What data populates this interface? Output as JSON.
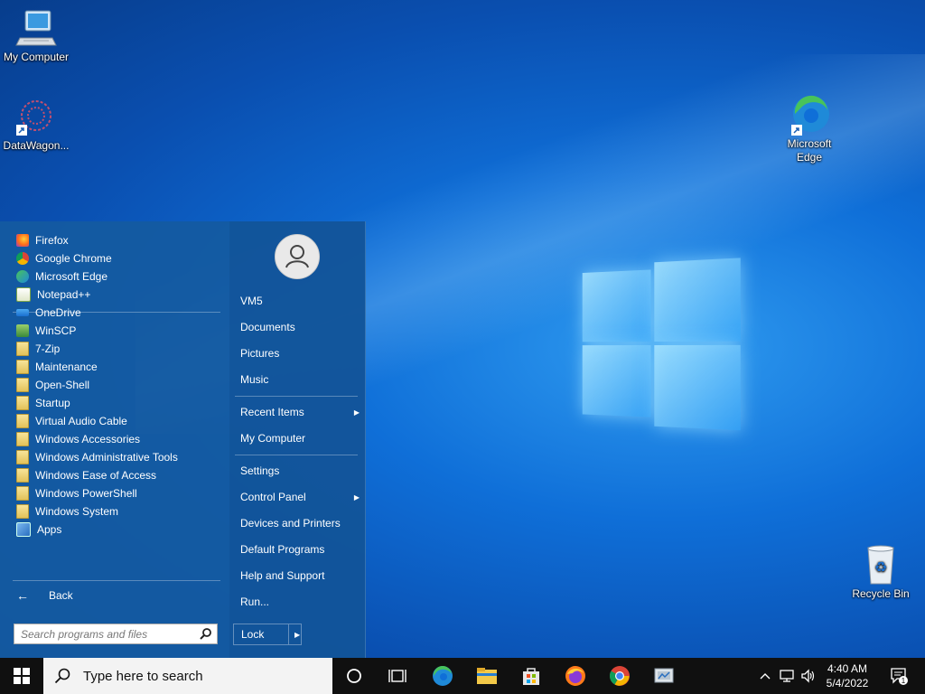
{
  "desktop": {
    "icons": [
      {
        "label": "My Computer"
      },
      {
        "label": "DataWagon..."
      },
      {
        "label": "Microsoft Edge"
      },
      {
        "label": "Recycle Bin"
      }
    ]
  },
  "start_menu": {
    "programs": [
      {
        "label": "Firefox",
        "icon": "firefox-icon"
      },
      {
        "label": "Google Chrome",
        "icon": "chrome-icon"
      },
      {
        "label": "Microsoft Edge",
        "icon": "edge-icon"
      },
      {
        "label": "Notepad++",
        "icon": "notepadpp-icon"
      },
      {
        "label": "OneDrive",
        "icon": "onedrive-icon"
      },
      {
        "label": "WinSCP",
        "icon": "winscp-icon"
      },
      {
        "label": "7-Zip",
        "icon": "folder-icon"
      },
      {
        "label": "Maintenance",
        "icon": "folder-icon"
      },
      {
        "label": "Open-Shell",
        "icon": "folder-icon"
      },
      {
        "label": "Startup",
        "icon": "folder-icon"
      },
      {
        "label": "Virtual Audio Cable",
        "icon": "folder-icon"
      },
      {
        "label": "Windows Accessories",
        "icon": "folder-icon"
      },
      {
        "label": "Windows Administrative Tools",
        "icon": "folder-icon"
      },
      {
        "label": "Windows Ease of Access",
        "icon": "folder-icon"
      },
      {
        "label": "Windows PowerShell",
        "icon": "folder-icon"
      },
      {
        "label": "Windows System",
        "icon": "folder-icon"
      },
      {
        "label": "Apps",
        "icon": "apps-icon"
      }
    ],
    "back_label": "Back",
    "search_placeholder": "Search programs and files",
    "right_items": {
      "user": "VM5",
      "documents": "Documents",
      "pictures": "Pictures",
      "music": "Music",
      "recent_items": "Recent Items",
      "my_computer": "My Computer",
      "settings": "Settings",
      "control_panel": "Control Panel",
      "devices_printers": "Devices and Printers",
      "default_programs": "Default Programs",
      "help_support": "Help and Support",
      "run": "Run..."
    },
    "lock_label": "Lock"
  },
  "taskbar": {
    "search_placeholder": "Type here to search",
    "time": "4:40 AM",
    "date": "5/4/2022",
    "notification_count": "1"
  },
  "colors": {
    "accent": "#145aa0",
    "taskbar": "#101010"
  }
}
